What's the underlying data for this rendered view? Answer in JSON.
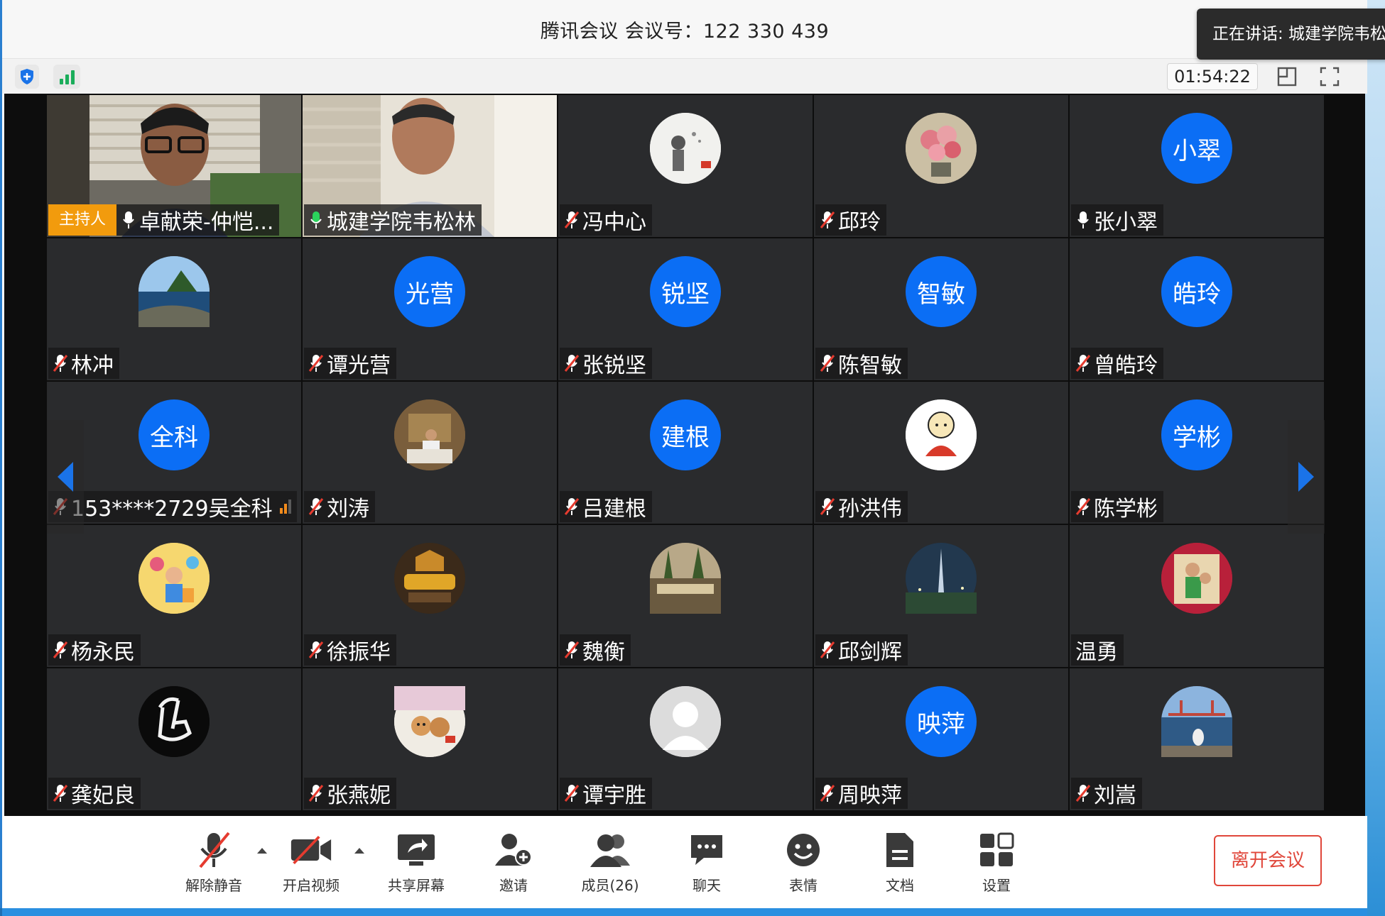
{
  "window": {
    "title": "腾讯会议 会议号：122 330 439",
    "speaking_toast": "正在讲话: 城建学院韦松林"
  },
  "infobar": {
    "timer": "01:54:22"
  },
  "colors": {
    "accent_blue": "#0b6ef5",
    "host_orange": "#f29b0d",
    "leave_red": "#e0463a",
    "tile_bg": "#2a2b2d"
  },
  "participants": [
    {
      "name": "卓献荣-仲恺...",
      "host_label": "主持人",
      "mic": "on-white",
      "avatar": "video"
    },
    {
      "name": "城建学院韦松林",
      "mic": "on-green",
      "avatar": "video"
    },
    {
      "name": "冯中心",
      "mic": "muted",
      "avatar": "photo"
    },
    {
      "name": "邱玲",
      "mic": "muted",
      "avatar": "photo"
    },
    {
      "name": "张小翠",
      "mic": "on-white",
      "avatar": "text",
      "avatar_text": "小翠"
    },
    {
      "name": "林冲",
      "mic": "muted",
      "avatar": "photo"
    },
    {
      "name": "谭光营",
      "mic": "muted",
      "avatar": "text",
      "avatar_text": "光营"
    },
    {
      "name": "张锐坚",
      "mic": "muted",
      "avatar": "text",
      "avatar_text": "锐坚"
    },
    {
      "name": "陈智敏",
      "mic": "muted",
      "avatar": "text",
      "avatar_text": "智敏"
    },
    {
      "name": "曾皓玲",
      "mic": "muted",
      "avatar": "text",
      "avatar_text": "皓玲"
    },
    {
      "name": "153****2729吴全科",
      "mic": "muted",
      "avatar": "text",
      "avatar_text": "全科",
      "signal_weak": true
    },
    {
      "name": "刘涛",
      "mic": "muted",
      "avatar": "photo"
    },
    {
      "name": "吕建根",
      "mic": "muted",
      "avatar": "text",
      "avatar_text": "建根"
    },
    {
      "name": "孙洪伟",
      "mic": "muted",
      "avatar": "photo"
    },
    {
      "name": "陈学彬",
      "mic": "muted",
      "avatar": "text",
      "avatar_text": "学彬"
    },
    {
      "name": "杨永民",
      "mic": "muted",
      "avatar": "photo"
    },
    {
      "name": "徐振华",
      "mic": "muted",
      "avatar": "photo"
    },
    {
      "name": "魏衡",
      "mic": "muted",
      "avatar": "photo"
    },
    {
      "name": "邱剑辉",
      "mic": "muted",
      "avatar": "photo"
    },
    {
      "name": "温勇",
      "mic": "none",
      "avatar": "photo"
    },
    {
      "name": "龚妃良",
      "mic": "muted",
      "avatar": "photo"
    },
    {
      "name": "张燕妮",
      "mic": "muted",
      "avatar": "photo"
    },
    {
      "name": "谭宇胜",
      "mic": "muted",
      "avatar": "photo"
    },
    {
      "name": "周映萍",
      "mic": "muted",
      "avatar": "text",
      "avatar_text": "映萍"
    },
    {
      "name": "刘嵩",
      "mic": "muted",
      "avatar": "photo"
    }
  ],
  "toolbar": {
    "unmute": "解除静音",
    "start_video": "开启视频",
    "share_screen": "共享屏幕",
    "invite": "邀请",
    "members": "成员(26)",
    "chat": "聊天",
    "reactions": "表情",
    "docs": "文档",
    "settings": "设置",
    "leave": "离开会议"
  }
}
